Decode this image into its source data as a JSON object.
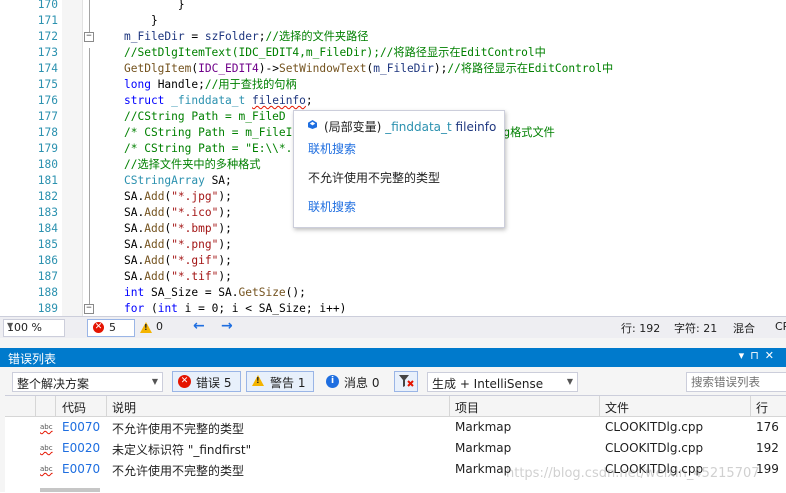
{
  "editor": {
    "lines": [
      {
        "num": "170",
        "tokens": [
          {
            "t": "        }",
            "c": ""
          }
        ]
      },
      {
        "num": "171",
        "tokens": [
          {
            "t": "    }",
            "c": ""
          }
        ]
      },
      {
        "num": "172",
        "tokens": [
          {
            "t": "m_FileDir",
            "c": "var"
          },
          {
            "t": " = ",
            "c": ""
          },
          {
            "t": "szFolder",
            "c": "var"
          },
          {
            "t": ";",
            "c": ""
          },
          {
            "t": "//选择的文件夹路径",
            "c": "cmt"
          }
        ]
      },
      {
        "num": "173",
        "tokens": [
          {
            "t": "//SetDlgItemText(IDC_EDIT4,m_FileDir);//将路径显示在EditControl中",
            "c": "cmt"
          }
        ]
      },
      {
        "num": "174",
        "tokens": [
          {
            "t": "GetDlgItem",
            "c": "fn"
          },
          {
            "t": "(",
            "c": ""
          },
          {
            "t": "IDC_EDIT4",
            "c": "mac"
          },
          {
            "t": ")->",
            "c": ""
          },
          {
            "t": "SetWindowText",
            "c": "fn"
          },
          {
            "t": "(",
            "c": ""
          },
          {
            "t": "m_FileDir",
            "c": "var"
          },
          {
            "t": ");",
            "c": ""
          },
          {
            "t": "//将路径显示在EditControl中",
            "c": "cmt"
          }
        ]
      },
      {
        "num": "175",
        "tokens": [
          {
            "t": "long",
            "c": "kw"
          },
          {
            "t": " Handle;",
            "c": ""
          },
          {
            "t": "//用于查找的句柄",
            "c": "cmt"
          }
        ]
      },
      {
        "num": "176",
        "tokens": [
          {
            "t": "struct",
            "c": "kw"
          },
          {
            "t": " ",
            "c": ""
          },
          {
            "t": "_finddata_t",
            "c": "ty"
          },
          {
            "t": " ",
            "c": ""
          },
          {
            "t": "fileinfo",
            "c": "var squig"
          },
          {
            "t": ";",
            "c": ""
          }
        ]
      },
      {
        "num": "177",
        "tokens": [
          {
            "t": "//CString Path = m_FileD",
            "c": "cmt"
          },
          {
            "t": "                           ",
            "c": ""
          },
          {
            "t": "件",
            "c": "cmt"
          }
        ]
      },
      {
        "num": "178",
        "tokens": [
          {
            "t": "/* CString Path = m_FileI",
            "c": "cmt"
          },
          {
            "t": "                          ",
            "c": ""
          },
          {
            "t": "中的jpg格式文件",
            "c": "cmt"
          }
        ]
      },
      {
        "num": "179",
        "tokens": [
          {
            "t": "/* CString Path = \"E:\\\\*.",
            "c": "cmt"
          },
          {
            "t": "                          ",
            "c": ""
          },
          {
            "t": "件",
            "c": "cmt"
          }
        ]
      },
      {
        "num": "180",
        "tokens": [
          {
            "t": "//选择文件夹中的多种格式",
            "c": "cmt"
          }
        ]
      },
      {
        "num": "181",
        "tokens": [
          {
            "t": "CStringArray",
            "c": "ty"
          },
          {
            "t": " SA;",
            "c": ""
          }
        ]
      },
      {
        "num": "182",
        "tokens": [
          {
            "t": "SA.",
            "c": ""
          },
          {
            "t": "Add",
            "c": "fn"
          },
          {
            "t": "(",
            "c": ""
          },
          {
            "t": "\"*.jpg\"",
            "c": "str"
          },
          {
            "t": ");",
            "c": ""
          }
        ]
      },
      {
        "num": "183",
        "tokens": [
          {
            "t": "SA.",
            "c": ""
          },
          {
            "t": "Add",
            "c": "fn"
          },
          {
            "t": "(",
            "c": ""
          },
          {
            "t": "\"*.ico\"",
            "c": "str"
          },
          {
            "t": ");",
            "c": ""
          }
        ]
      },
      {
        "num": "184",
        "tokens": [
          {
            "t": "SA.",
            "c": ""
          },
          {
            "t": "Add",
            "c": "fn"
          },
          {
            "t": "(",
            "c": ""
          },
          {
            "t": "\"*.bmp\"",
            "c": "str"
          },
          {
            "t": ");",
            "c": ""
          }
        ]
      },
      {
        "num": "185",
        "tokens": [
          {
            "t": "SA.",
            "c": ""
          },
          {
            "t": "Add",
            "c": "fn"
          },
          {
            "t": "(",
            "c": ""
          },
          {
            "t": "\"*.png\"",
            "c": "str"
          },
          {
            "t": ");",
            "c": ""
          }
        ]
      },
      {
        "num": "186",
        "tokens": [
          {
            "t": "SA.",
            "c": ""
          },
          {
            "t": "Add",
            "c": "fn"
          },
          {
            "t": "(",
            "c": ""
          },
          {
            "t": "\"*.gif\"",
            "c": "str"
          },
          {
            "t": ");",
            "c": ""
          }
        ]
      },
      {
        "num": "187",
        "tokens": [
          {
            "t": "SA.",
            "c": ""
          },
          {
            "t": "Add",
            "c": "fn"
          },
          {
            "t": "(",
            "c": ""
          },
          {
            "t": "\"*.tif\"",
            "c": "str"
          },
          {
            "t": ");",
            "c": ""
          }
        ]
      },
      {
        "num": "188",
        "tokens": [
          {
            "t": "int",
            "c": "kw"
          },
          {
            "t": " SA_Size = SA.",
            "c": ""
          },
          {
            "t": "GetSize",
            "c": "fn"
          },
          {
            "t": "();",
            "c": ""
          }
        ]
      },
      {
        "num": "189",
        "tokens": [
          {
            "t": "for",
            "c": "kw"
          },
          {
            "t": " (",
            "c": ""
          },
          {
            "t": "int",
            "c": "kw"
          },
          {
            "t": " i = 0; i < SA_Size; i++)",
            "c": ""
          }
        ]
      }
    ],
    "fold_markers": [
      "172",
      "189"
    ]
  },
  "tooltip": {
    "scope": "(局部变量)",
    "type_name": "_finddata_t",
    "var_name": "fileinfo",
    "link1": "联机搜索",
    "message": "不允许使用不完整的类型",
    "link2": "联机搜索"
  },
  "editor_status": {
    "zoom": "100 %",
    "errors": "5",
    "warnings": "0",
    "line": "行: 192",
    "char": "字符: 21",
    "mode": "混合",
    "eol": "CR"
  },
  "error_list": {
    "title": "错误列表",
    "scope_value": "整个解决方案",
    "errors_btn": "错误 5",
    "warnings_btn": "警告 1",
    "messages_btn": "消息 0",
    "build_value": "生成 + IntelliSense",
    "search_placeholder": "搜索错误列表",
    "columns": {
      "code": "代码",
      "desc": "说明",
      "project": "项目",
      "file": "文件",
      "line": "行"
    },
    "rows": [
      {
        "code": "E0070",
        "desc": "不允许使用不完整的类型",
        "project": "Markmap",
        "file": "CLOOKITDlg.cpp",
        "line": "176"
      },
      {
        "code": "E0020",
        "desc": "未定义标识符 \"_findfirst\"",
        "project": "Markmap",
        "file": "CLOOKITDlg.cpp",
        "line": "192"
      },
      {
        "code": "E0070",
        "desc": "不允许使用不完整的类型",
        "project": "Markmap",
        "file": "CLOOKITDlg.cpp",
        "line": "199"
      }
    ]
  },
  "watermark": "https://blog.csdn.net/weixin_45215707",
  "colors": {
    "accent": "#007acc",
    "error": "#e51400",
    "warning": "#f4b400",
    "link": "#1e6ee0"
  }
}
